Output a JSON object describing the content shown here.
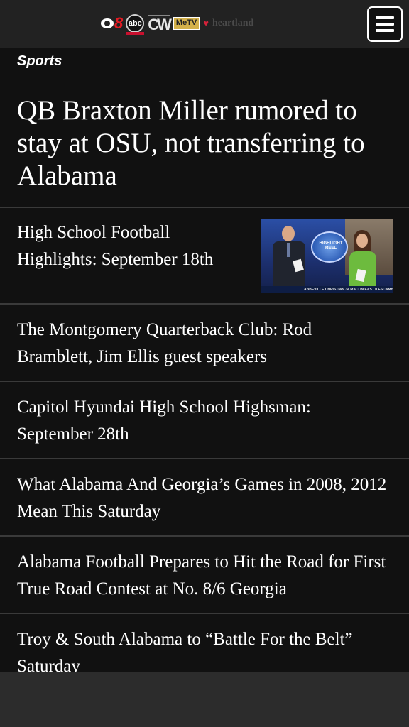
{
  "header": {
    "logos": {
      "channel_8": "8",
      "abc": "abc",
      "cw": "CW",
      "metv": "MeTV",
      "heartland": "heartland"
    },
    "menu_icon": "hamburger-menu-icon"
  },
  "content": {
    "section_label": "Sports",
    "lead_story": "QB Braxton Miller rumored to stay at OSU, not transferring to Alabama",
    "stories": [
      {
        "title": "High School Football Highlights: September 18th",
        "thumbnail": {
          "screen_text": "HIGHLIGHT REEL",
          "ticker_text": "ABBEVILLE CHRISTIAN 34 MACON EAST 0   ESCAMB"
        }
      },
      {
        "title": "The Montgomery Quarterback Club: Rod Bramblett, Jim Ellis guest speakers"
      },
      {
        "title": "Capitol Hyundai High School Highsman: September 28th"
      },
      {
        "title": "What Alabama And Georgia’s Games in 2008, 2012 Mean This Saturday"
      },
      {
        "title": "Alabama Football Prepares to Hit the Road for First True Road Contest at No. 8/6 Georgia"
      },
      {
        "title": "Troy & South Alabama to “Battle For the Belt” Saturday"
      }
    ]
  },
  "colors": {
    "header_bg": "#222222",
    "content_bg": "#111111",
    "divider": "#3a3a3a",
    "text": "#ffffff",
    "accent_red": "#e31b23"
  }
}
